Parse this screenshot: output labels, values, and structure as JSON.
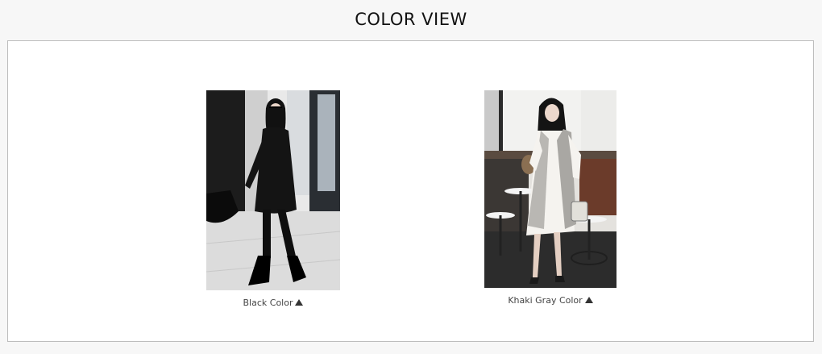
{
  "section": {
    "title": "COLOR VIEW"
  },
  "items": [
    {
      "caption": "Black Color",
      "image_icon": "model-black-coat-photo",
      "indicator_icon": "triangle-up-icon"
    },
    {
      "caption": "Khaki Gray Color",
      "image_icon": "model-gray-vest-photo",
      "indicator_icon": "triangle-up-icon"
    }
  ],
  "colors": {
    "background": "#f7f7f7",
    "frame_border": "#bdbdbd",
    "text": "#444444"
  }
}
